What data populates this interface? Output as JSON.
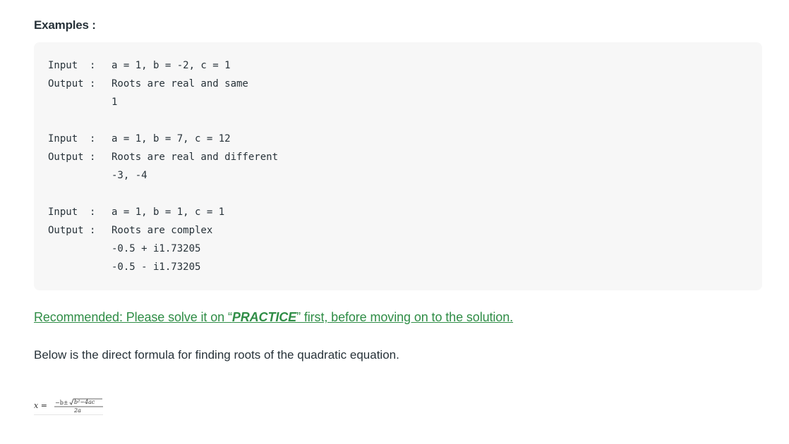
{
  "section": {
    "heading": "Examples :"
  },
  "examples": [
    {
      "input_label": "Input  :",
      "input_value": "a = 1, b = -2, c = 1",
      "output_label": "Output :",
      "output_lines": [
        "Roots are real and same",
        "1"
      ]
    },
    {
      "input_label": "Input  :",
      "input_value": "a = 1, b = 7, c = 12",
      "output_label": "Output :",
      "output_lines": [
        "Roots are real and different",
        "-3, -4"
      ]
    },
    {
      "input_label": "Input  :",
      "input_value": "a = 1, b = 1, c = 1",
      "output_label": "Output :",
      "output_lines": [
        "Roots are complex",
        "-0.5 + i1.73205",
        "-0.5 - i1.73205"
      ]
    }
  ],
  "recommendation": {
    "prefix": "Recommended: Please solve it on “",
    "emphasis": "PRACTICE",
    "suffix": "” first, before moving on to the solution."
  },
  "body": {
    "paragraph": "Below is the direct formula for finding roots of the quadratic equation."
  },
  "formula": {
    "lhs": "x =",
    "numerator_prefix": "−b±",
    "radicand": "b²−4ac",
    "denominator": "2a"
  }
}
